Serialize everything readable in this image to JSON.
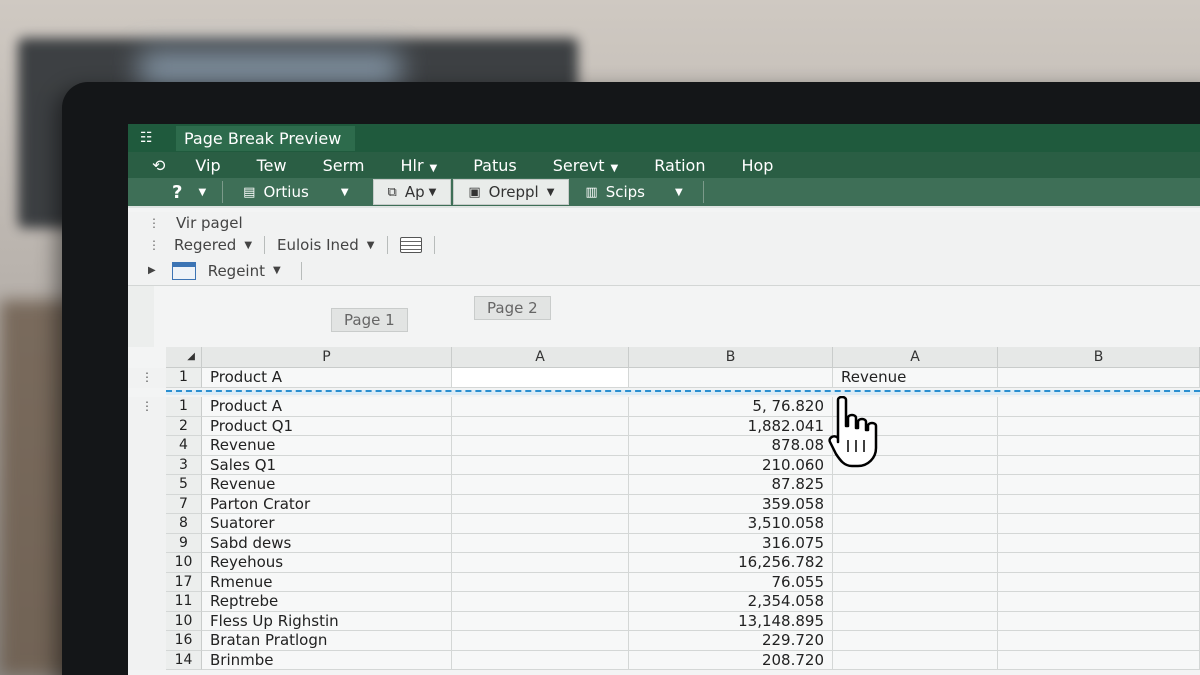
{
  "app": {
    "title": "Page Break Preview",
    "title_icon": "grid-icon"
  },
  "menu": [
    {
      "label": "Vip",
      "chev": false
    },
    {
      "label": "Tew",
      "chev": false
    },
    {
      "label": "Serm",
      "chev": false
    },
    {
      "label": "Hlr",
      "chev": true
    },
    {
      "label": "Patus",
      "chev": false
    },
    {
      "label": "Serevt",
      "chev": true
    },
    {
      "label": "Ration",
      "chev": false
    },
    {
      "label": "Hop",
      "chev": false
    }
  ],
  "ribbon": {
    "help": "?",
    "ortius": "Ortius",
    "ap": "Ap",
    "oreppl": "Oreppl",
    "scips": "Scips"
  },
  "subbar1": {
    "label": "Vir pagel"
  },
  "subbar2": {
    "regered": "Regered",
    "eulois": "Eulois Ined"
  },
  "subbar3": {
    "regeint": "Regeint"
  },
  "pages": {
    "page1": "Page 1",
    "page2": "Page 2"
  },
  "columns": [
    "P",
    "A",
    "B",
    "A",
    "B"
  ],
  "header_row": {
    "num": "1",
    "p": "Product A",
    "d": "Revenue"
  },
  "rows": [
    {
      "num": "1",
      "p": "Product A",
      "b": "5, 76.820"
    },
    {
      "num": "2",
      "p": "Product Q1",
      "b": "1,882.041"
    },
    {
      "num": "4",
      "p": "Revenue",
      "b": "878.08"
    },
    {
      "num": "3",
      "p": "Sales Q1",
      "b": "210.060"
    },
    {
      "num": "5",
      "p": "Revenue",
      "b": "87.825"
    },
    {
      "num": "7",
      "p": "Parton Crator",
      "b": "359.058"
    },
    {
      "num": "8",
      "p": "Suatorer",
      "b": "3,510.058"
    },
    {
      "num": "9",
      "p": "Sabd dews",
      "b": "316.075"
    },
    {
      "num": "10",
      "p": "Reyehous",
      "b": "16,256.782"
    },
    {
      "num": "17",
      "p": "Rmenue",
      "b": "76.055"
    },
    {
      "num": "11",
      "p": "Reptrebe",
      "b": "2,354.058"
    },
    {
      "num": "10",
      "p": "Fless Up Righstin",
      "b": "13,148.895"
    },
    {
      "num": "16",
      "p": "Bratan Pratlogn",
      "b": "229.720"
    },
    {
      "num": "14",
      "p": "Brinmbe",
      "b": "208.720"
    }
  ]
}
